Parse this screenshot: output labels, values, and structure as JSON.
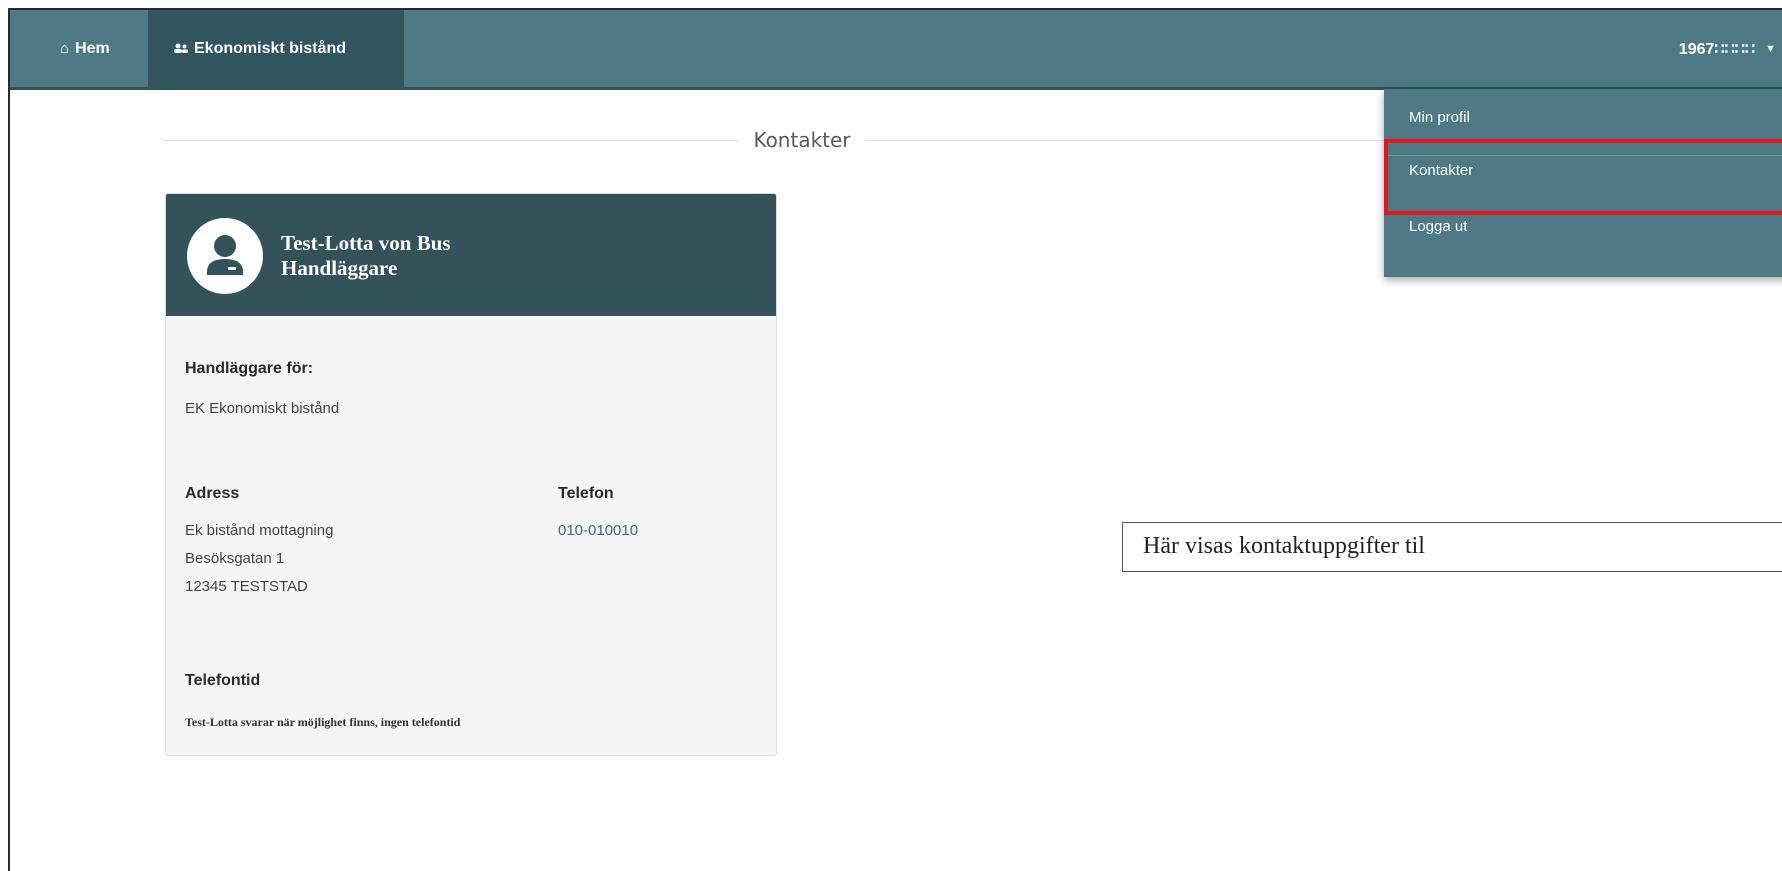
{
  "nav": {
    "home_label": "Hem",
    "ek_label": "Ekonomiskt bistånd",
    "user_label": "1967∷∷∷∷"
  },
  "dropdown": {
    "items": [
      "Min profil",
      "Kontakter",
      "Logga ut"
    ],
    "highlighted_item": "Kontakter",
    "highlight_color": "#e6161d"
  },
  "page": {
    "title": "Kontakter"
  },
  "contact": {
    "name": "Test-Lotta von Bus",
    "role": "Handläggare",
    "for_label": "Handläggare för:",
    "for_value": "EK Ekonomiskt bistånd",
    "address_label": "Adress",
    "address_lines": [
      "Ek bistånd mottagning",
      "Besöksgatan 1",
      "12345 TESTSTAD"
    ],
    "phone_label": "Telefon",
    "phone_value": "010-010010",
    "phonetime_label": "Telefontid",
    "phonetime_value": "Test-Lotta svarar när möjlighet finns, ingen telefontid"
  },
  "callout": {
    "text": "Här visas kontaktuppgifter til"
  },
  "colors": {
    "navbar": "#4e7a85",
    "nav_active": "#33555f",
    "card_header": "#33525a",
    "link": "#3b6d82"
  },
  "icons": {
    "home": "home-icon",
    "ek": "people-icon",
    "caret": "caret-down-icon",
    "avatar": "user-avatar-icon"
  }
}
